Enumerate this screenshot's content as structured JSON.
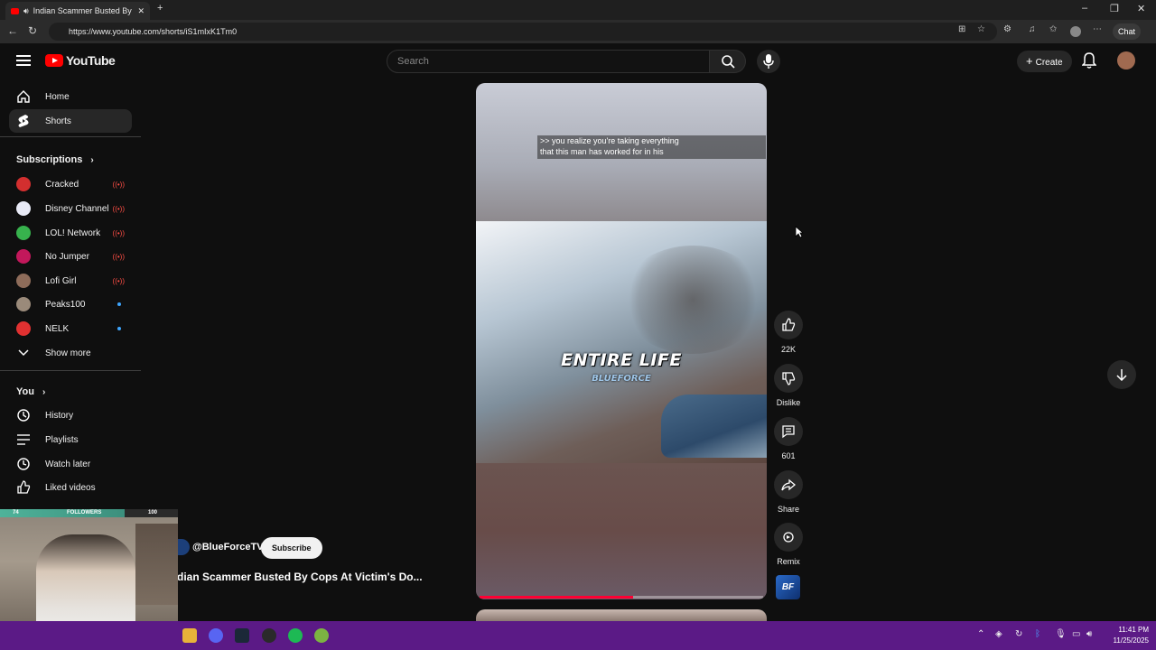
{
  "browser": {
    "tab_title": "Indian Scammer Busted By C",
    "url": "https://www.youtube.com/shorts/iS1mIxK1Tm0",
    "chat_label": "Chat"
  },
  "header": {
    "logo_text": "YouTube",
    "search_placeholder": "Search",
    "create_label": "Create"
  },
  "sidebar": {
    "main": [
      {
        "label": "Home",
        "icon": "home-icon"
      },
      {
        "label": "Shorts",
        "icon": "shorts-icon",
        "active": true
      }
    ],
    "subscriptions_title": "Subscriptions",
    "subscriptions": [
      {
        "label": "Cracked",
        "color": "#d32f2f",
        "indicator": "live"
      },
      {
        "label": "Disney Channel",
        "color": "#e8eaf6",
        "indicator": "live"
      },
      {
        "label": "LOL! Network",
        "color": "#37b24d",
        "indicator": "live"
      },
      {
        "label": "No Jumper",
        "color": "#c2185b",
        "indicator": "live"
      },
      {
        "label": "Lofi Girl",
        "color": "#8e6c5a",
        "indicator": "live"
      },
      {
        "label": "Peaks100",
        "color": "#9a8a7a",
        "indicator": "new"
      },
      {
        "label": "NELK",
        "color": "#e03131",
        "indicator": "new"
      }
    ],
    "show_more": "Show more",
    "you_title": "You",
    "you_items": [
      {
        "label": "History",
        "icon": "history-icon"
      },
      {
        "label": "Playlists",
        "icon": "playlists-icon"
      },
      {
        "label": "Watch later",
        "icon": "watch-later-icon"
      },
      {
        "label": "Liked videos",
        "icon": "liked-videos-icon"
      }
    ]
  },
  "short": {
    "caption_line1": ">> you realize you're taking everything",
    "caption_line2": "that this man has worked for in his",
    "caption_line3": "entire",
    "overlay_title": "ENTIRE LIFE",
    "overlay_brand": "BLUEFORCE",
    "progress": 0.54,
    "channel": "@BlueForceTV",
    "subscribe_label": "Subscribe",
    "title": "dian Scammer Busted By Cops At Victim's Do..."
  },
  "actions": {
    "like_count": "22K",
    "dislike_label": "Dislike",
    "comment_count": "601",
    "share_label": "Share",
    "remix_label": "Remix",
    "thumb_text": "BF"
  },
  "webcam": {
    "followers_label": "FOLLOWERS",
    "left_count": "74",
    "right_count": "100"
  },
  "taskbar": {
    "time": "11:41 PM",
    "date": "11/25/2025"
  }
}
